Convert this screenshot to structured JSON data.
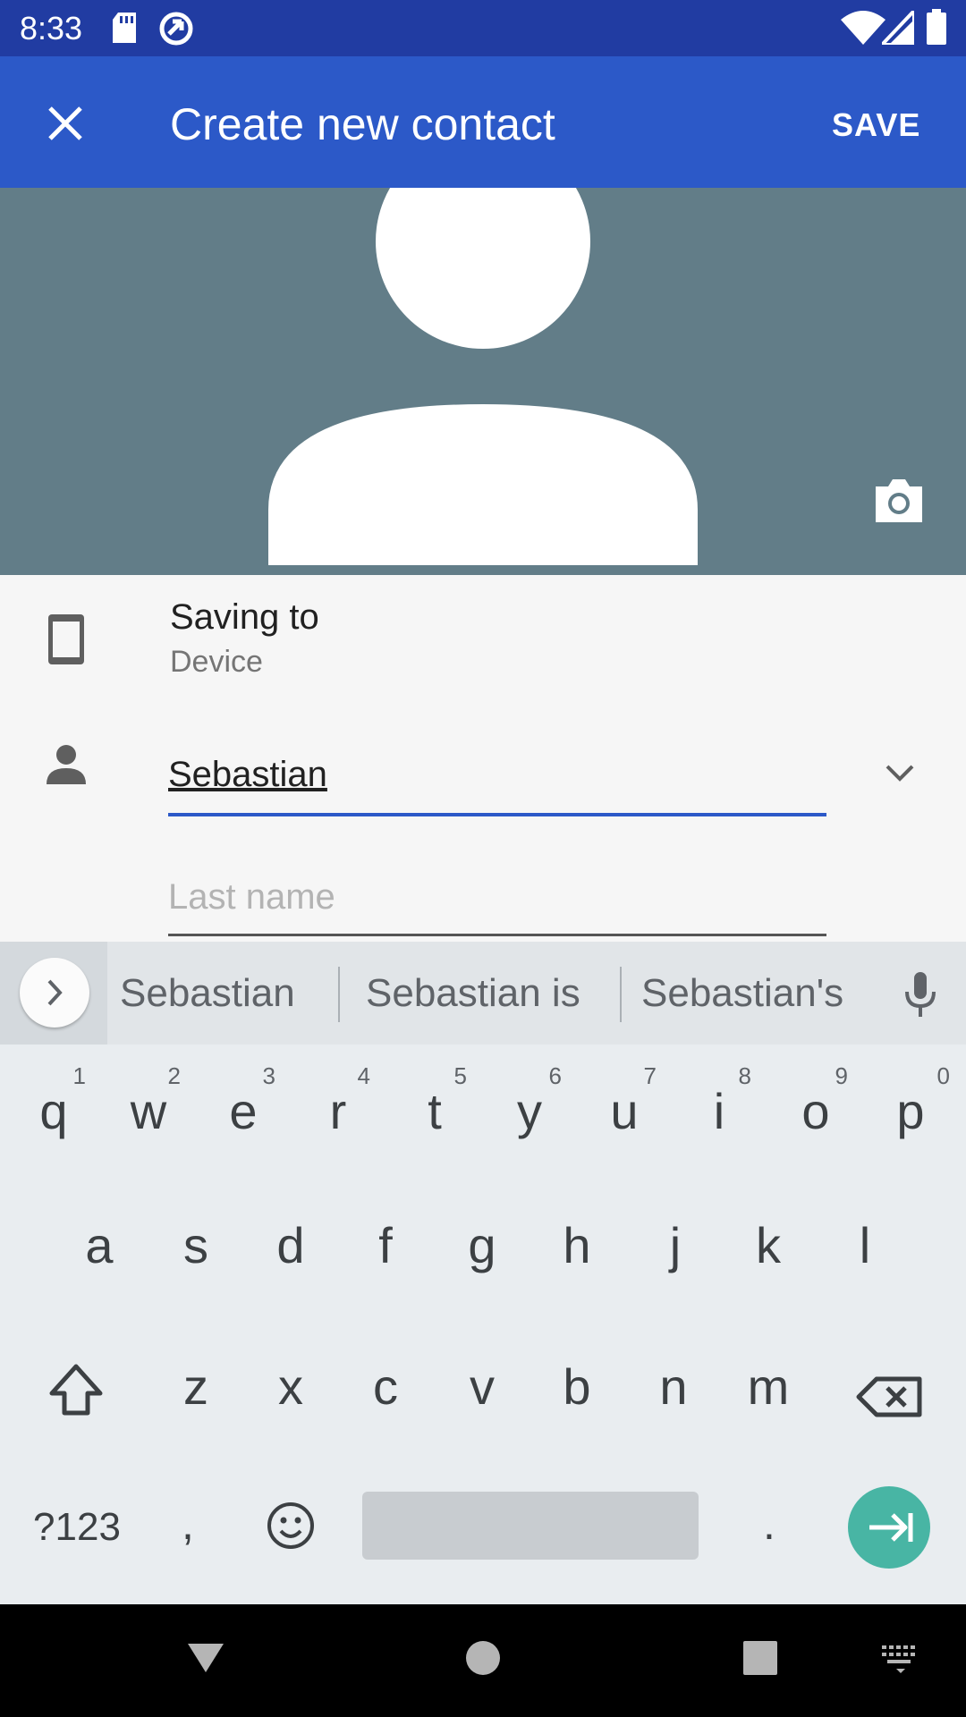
{
  "status_bar": {
    "time": "8:33",
    "icons": [
      "sd-card-icon",
      "sync-icon",
      "wifi-icon",
      "signal-icon",
      "battery-icon"
    ]
  },
  "toolbar": {
    "close_icon": "close-icon",
    "title": "Create new contact",
    "save_label": "SAVE"
  },
  "photo": {
    "icons": [
      "avatar-placeholder-icon",
      "camera-icon"
    ]
  },
  "form": {
    "saving_to_label": "Saving to",
    "saving_to_account": "Device",
    "first_name_value": "Sebastian",
    "last_name_placeholder": "Last name"
  },
  "suggestions": {
    "items": [
      "Sebastian",
      "Sebastian is",
      "Sebastian's"
    ],
    "icons": [
      "chevron-right-icon",
      "microphone-icon"
    ]
  },
  "keyboard": {
    "row1": [
      {
        "key": "q",
        "hint": "1"
      },
      {
        "key": "w",
        "hint": "2"
      },
      {
        "key": "e",
        "hint": "3"
      },
      {
        "key": "r",
        "hint": "4"
      },
      {
        "key": "t",
        "hint": "5"
      },
      {
        "key": "y",
        "hint": "6"
      },
      {
        "key": "u",
        "hint": "7"
      },
      {
        "key": "i",
        "hint": "8"
      },
      {
        "key": "o",
        "hint": "9"
      },
      {
        "key": "p",
        "hint": "0"
      }
    ],
    "row2": [
      "a",
      "s",
      "d",
      "f",
      "g",
      "h",
      "j",
      "k",
      "l"
    ],
    "row3": [
      "z",
      "x",
      "c",
      "v",
      "b",
      "n",
      "m"
    ],
    "symbols_label": "?123",
    "comma": ",",
    "period": ".",
    "icons": [
      "shift-icon",
      "backspace-icon",
      "emoji-icon",
      "enter-next-icon"
    ]
  },
  "navbar": {
    "icons": [
      "back-icon",
      "home-icon",
      "recents-icon",
      "keyboard-switch-icon"
    ]
  },
  "colors": {
    "status_bar": "#213ca2",
    "toolbar": "#2c59c8",
    "photo_bg": "#627d88",
    "accent_teal": "#48b5a4"
  }
}
